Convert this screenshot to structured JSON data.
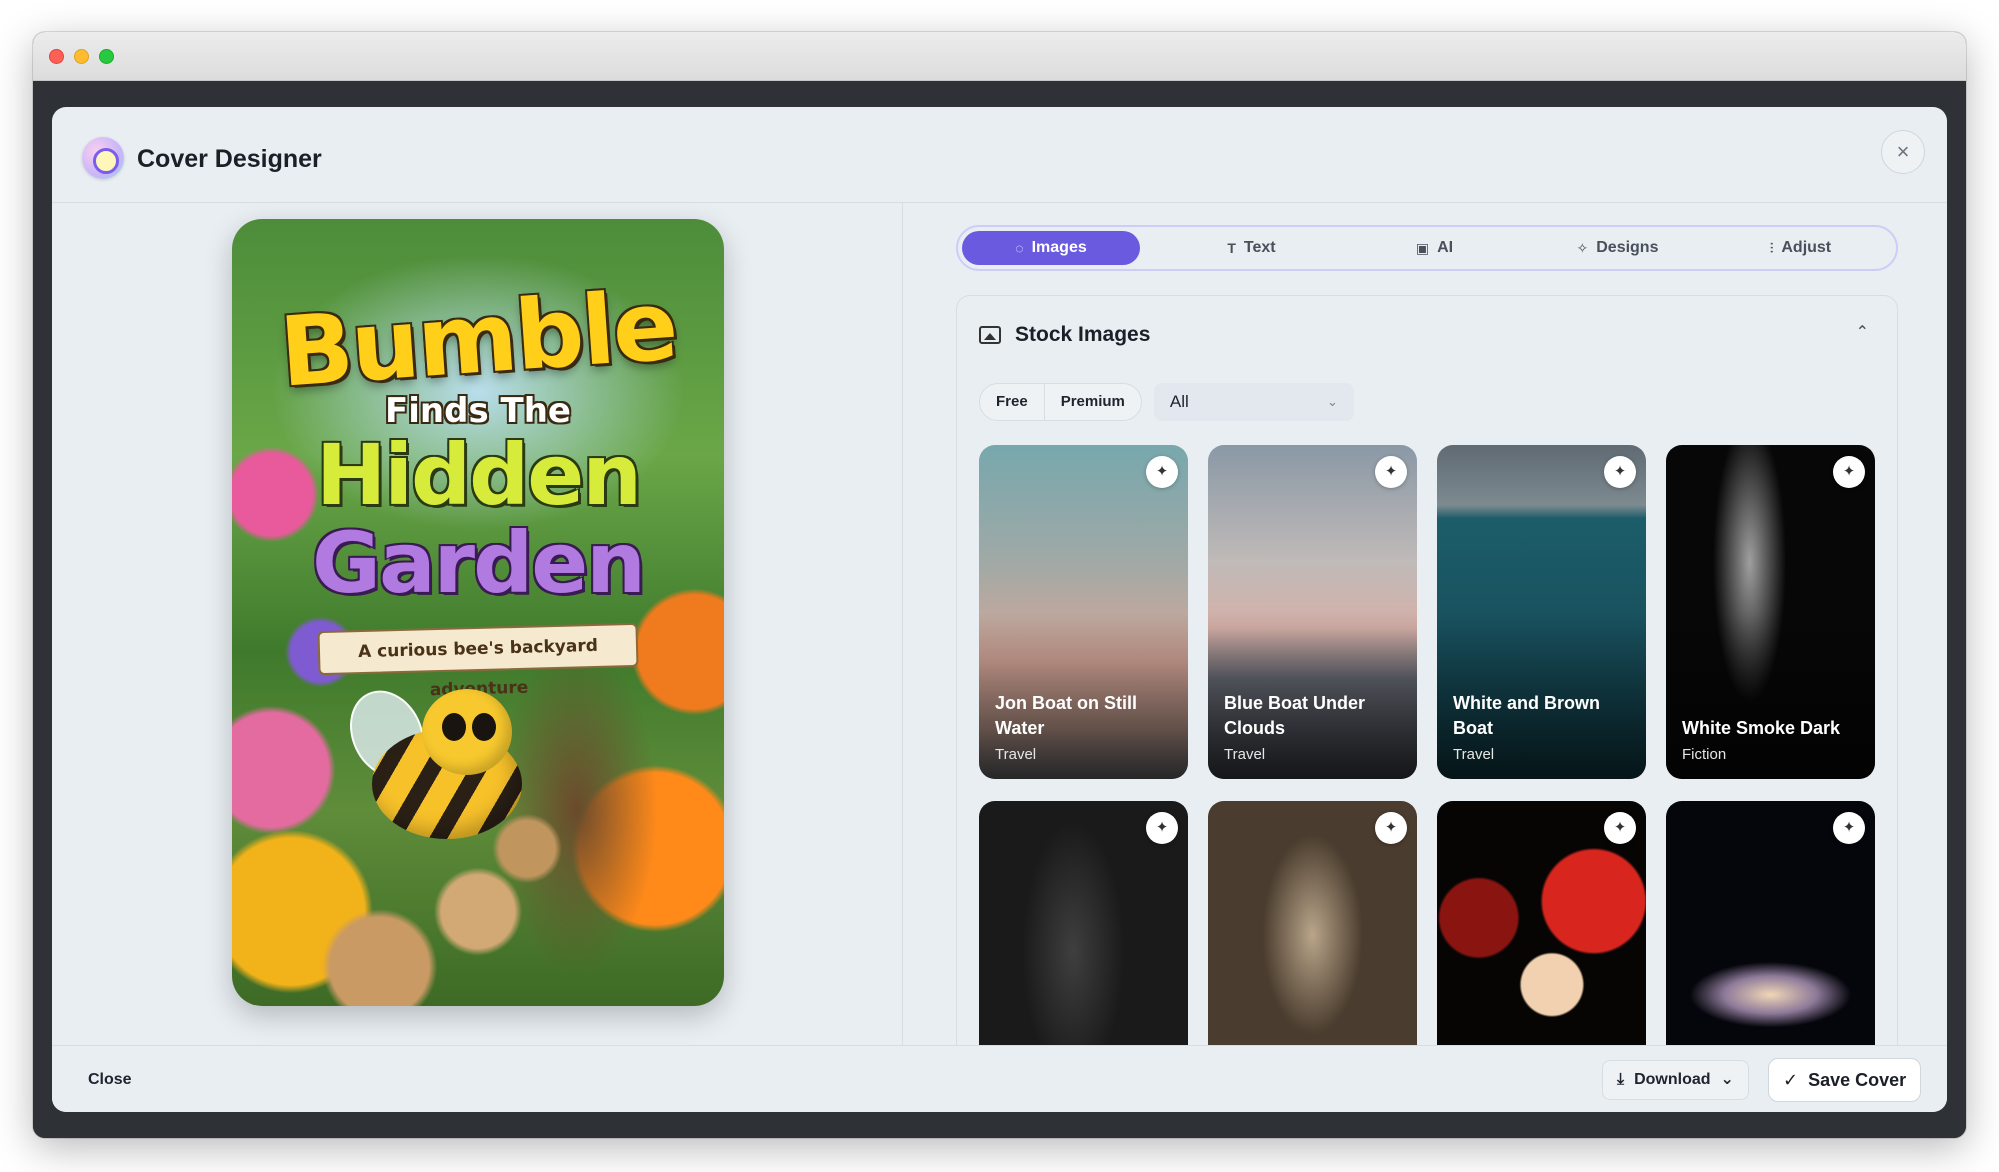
{
  "window": {
    "traffic_lights": [
      "close",
      "minimize",
      "zoom"
    ]
  },
  "dialog": {
    "title": "Cover Designer",
    "close_icon": "×",
    "logo_icon": "palette-icon"
  },
  "cover": {
    "title_line1": "Bumble",
    "title_line2": "Finds The",
    "title_line3": "Hidden",
    "title_line4": "Garden",
    "tagline": "A curious bee's backyard adventure"
  },
  "tabs": [
    {
      "label": "Images",
      "icon": "◌",
      "active": true
    },
    {
      "label": "Text",
      "icon": "T",
      "active": false
    },
    {
      "label": "AI",
      "icon": "▣",
      "active": false
    },
    {
      "label": "Designs",
      "icon": "✧",
      "active": false
    },
    {
      "label": "Adjust",
      "icon": "⫶",
      "active": false
    }
  ],
  "stock": {
    "title": "Stock Images",
    "collapse_icon": "⌃",
    "filters": {
      "free": "Free",
      "premium": "Premium"
    },
    "category_select": {
      "value": "All",
      "caret": "⌄"
    },
    "sparkle_icon": "✦",
    "images": [
      {
        "title": "Jon Boat on Still Water",
        "category": "Travel"
      },
      {
        "title": "Blue Boat Under Clouds",
        "category": "Travel"
      },
      {
        "title": "White and Brown Boat",
        "category": "Travel"
      },
      {
        "title": "White Smoke Dark",
        "category": "Fiction"
      },
      {
        "title": "",
        "category": ""
      },
      {
        "title": "",
        "category": ""
      },
      {
        "title": "",
        "category": ""
      },
      {
        "title": "",
        "category": ""
      }
    ]
  },
  "footer": {
    "close_label": "Close",
    "download_label": "Download",
    "download_icon": "⤓",
    "download_caret": "⌄",
    "save_label": "Save Cover",
    "save_icon": "✓"
  },
  "colors": {
    "accent": "#6a5ae0",
    "dialog_bg": "#e8eef2",
    "backdrop": "#2e3135"
  }
}
